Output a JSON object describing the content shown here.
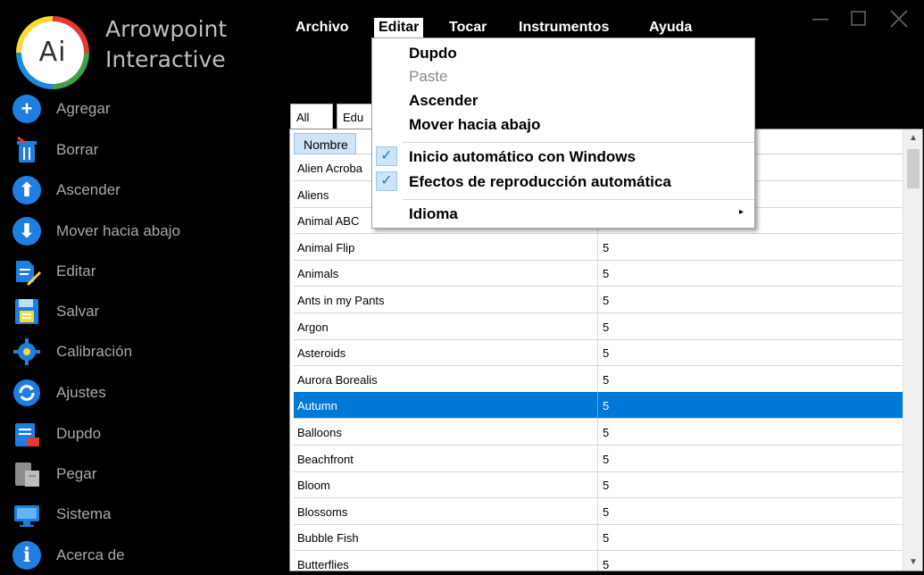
{
  "app": {
    "logo_text": "Ai",
    "brand_line1": "Arrowpoint",
    "brand_line2": "Interactive"
  },
  "sidebar": {
    "items": [
      {
        "label": "Agregar",
        "icon": "add-icon"
      },
      {
        "label": "Borrar",
        "icon": "trash-icon"
      },
      {
        "label": "Ascender",
        "icon": "arrow-up-icon"
      },
      {
        "label": "Mover hacia abajo",
        "icon": "arrow-down-icon"
      },
      {
        "label": "Editar",
        "icon": "edit-icon"
      },
      {
        "label": "Salvar",
        "icon": "save-icon"
      },
      {
        "label": "Calibración",
        "icon": "calibration-gear-icon"
      },
      {
        "label": "Ajustes",
        "icon": "settings-sync-icon"
      },
      {
        "label": "Dupdo",
        "icon": "copy-icon"
      },
      {
        "label": "Pegar",
        "icon": "paste-icon"
      },
      {
        "label": "Sistema",
        "icon": "system-monitor-icon"
      },
      {
        "label": "Acerca de",
        "icon": "info-icon"
      }
    ]
  },
  "menubar": {
    "items": [
      "Archivo",
      "Editar",
      "Tocar",
      "Instrumentos",
      "Ayuda"
    ],
    "active": "Editar"
  },
  "edit_menu": {
    "items": [
      {
        "label": "Dupdo",
        "enabled": true
      },
      {
        "label": "Paste",
        "enabled": false
      },
      {
        "label": "Ascender",
        "enabled": true
      },
      {
        "label": "Mover hacia abajo",
        "enabled": true
      },
      {
        "label": "Inicio automático con Windows",
        "checked": true
      },
      {
        "label": "Efectos de reproducción automática",
        "checked": true
      },
      {
        "label": "Idioma",
        "submenu": true
      }
    ]
  },
  "tabs": [
    "All",
    "Edu"
  ],
  "table": {
    "header": "Nombre",
    "rows": [
      {
        "name": "Alien Acroba",
        "value": ""
      },
      {
        "name": "Aliens",
        "value": ""
      },
      {
        "name": "Animal ABC",
        "value": ""
      },
      {
        "name": "Animal Flip",
        "value": "5"
      },
      {
        "name": "Animals",
        "value": "5"
      },
      {
        "name": "Ants in my Pants",
        "value": "5"
      },
      {
        "name": "Argon",
        "value": "5"
      },
      {
        "name": "Asteroids",
        "value": "5"
      },
      {
        "name": "Aurora Borealis",
        "value": "5"
      },
      {
        "name": "Autumn",
        "value": "5",
        "selected": true
      },
      {
        "name": "Balloons",
        "value": "5"
      },
      {
        "name": "Beachfront",
        "value": "5"
      },
      {
        "name": "Bloom",
        "value": "5"
      },
      {
        "name": "Blossoms",
        "value": "5"
      },
      {
        "name": "Bubble Fish",
        "value": "5"
      },
      {
        "name": "Butterflies",
        "value": "5"
      }
    ]
  },
  "colors": {
    "accent": "#0078d7",
    "sidebar_text": "#a8a8a8",
    "icon_blue": "#1e7fe0"
  }
}
